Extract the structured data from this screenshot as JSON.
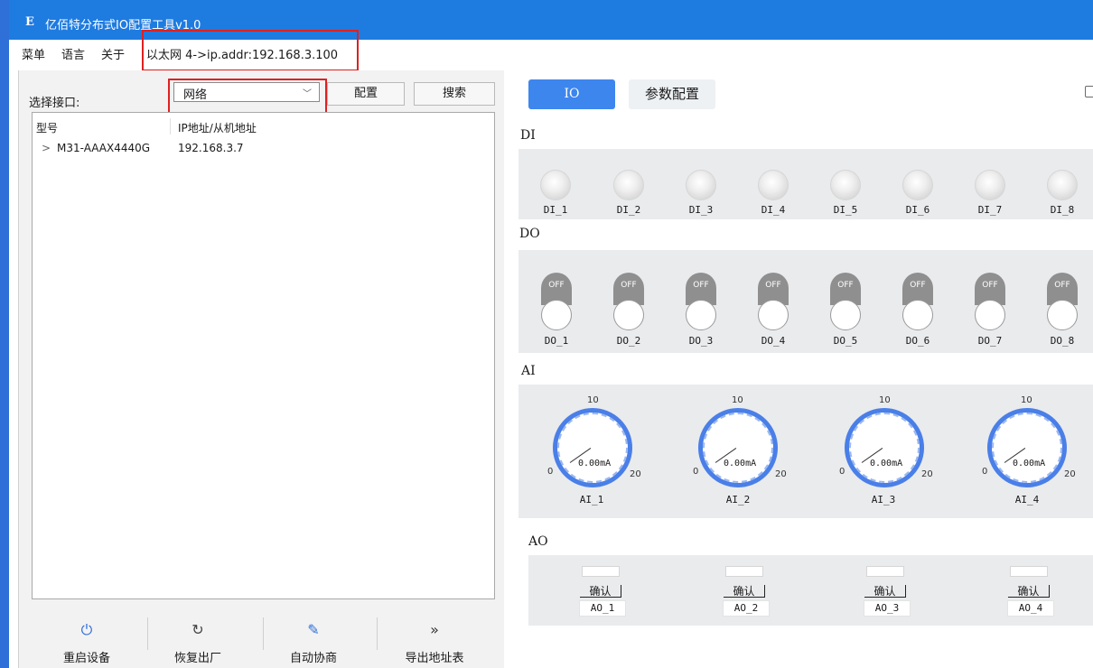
{
  "window": {
    "logo": "E",
    "title": "亿佰特分布式IO配置工具v1.0"
  },
  "menubar": {
    "items": [
      "菜单",
      "语言",
      "关于"
    ],
    "connection": "以太网 4->ip.addr:192.168.3.100"
  },
  "left": {
    "interface_label": "选择接口:",
    "interface_value": "网络",
    "config_button": "配置",
    "search_button": "搜索",
    "columns": [
      "型号",
      "IP地址/从机地址"
    ],
    "devices": [
      {
        "expander": ">",
        "model": "M31-AAAX4440G",
        "address": "192.168.3.7"
      }
    ],
    "actions": [
      {
        "label": "重启设备",
        "icon": "power-icon",
        "glyph": "⏻"
      },
      {
        "label": "恢复出厂",
        "icon": "refresh-icon",
        "glyph": "↻"
      },
      {
        "label": "自动协商",
        "icon": "edit-icon",
        "glyph": "✎"
      },
      {
        "label": "导出地址表",
        "icon": "double-chevron-right-icon",
        "glyph": "»"
      }
    ]
  },
  "right": {
    "tabs": [
      "IO",
      "参数配置"
    ],
    "active_tab": "IO",
    "di": {
      "title": "DI",
      "channels": [
        "DI_1",
        "DI_2",
        "DI_3",
        "DI_4",
        "DI_5",
        "DI_6",
        "DI_7",
        "DI_8"
      ]
    },
    "do": {
      "title": "DO",
      "state": "OFF",
      "channels": [
        "DO_1",
        "DO_2",
        "DO_3",
        "DO_4",
        "DO_5",
        "DO_6",
        "DO_7",
        "DO_8"
      ]
    },
    "ai": {
      "title": "AI",
      "max_label": "10",
      "min_label": "0",
      "end_label": "20",
      "channels": [
        {
          "name": "AI_1",
          "value": "0.00mA"
        },
        {
          "name": "AI_2",
          "value": "0.00mA"
        },
        {
          "name": "AI_3",
          "value": "0.00mA"
        },
        {
          "name": "AI_4",
          "value": "0.00mA"
        }
      ]
    },
    "ao": {
      "title": "AO",
      "confirm_label": "确认",
      "channels": [
        "AO_1",
        "AO_2",
        "AO_3",
        "AO_4"
      ]
    }
  },
  "colors": {
    "titlebar": "#1e7be0",
    "accent": "#3d86ee",
    "highlight_box": "#e02020",
    "gauge_ring": "#4a7fe8"
  }
}
